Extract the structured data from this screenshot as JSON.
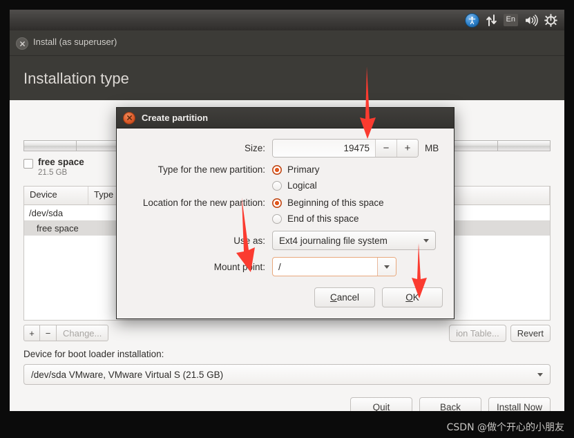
{
  "panel": {
    "tray": [
      {
        "name": "accessibility-icon",
        "label": "Accessibility"
      },
      {
        "name": "network-icon",
        "label": "Network"
      },
      {
        "name": "keyboard-layout-indicator",
        "label": "En"
      },
      {
        "name": "volume-icon",
        "label": "Volume"
      },
      {
        "name": "system-menu-icon",
        "label": "System"
      }
    ],
    "keyboard_layout": "En"
  },
  "installer": {
    "window_title": "Install (as superuser)",
    "page_title": "Installation type",
    "legend": {
      "name": "free space",
      "size": "21.5 GB"
    },
    "table": {
      "columns": [
        "Device",
        "Type",
        ""
      ],
      "rows": [
        {
          "device": "/dev/sda",
          "type": "",
          "extra": ""
        },
        {
          "device": "free space",
          "type": "",
          "extra": ""
        }
      ]
    },
    "toolbar": {
      "add_label": "+",
      "remove_label": "−",
      "change_label": "Change...",
      "new_partition_table_label": "ion Table...",
      "revert_label": "Revert"
    },
    "bootloader": {
      "label": "Device for boot loader installation:",
      "value": "/dev/sda VMware, VMware Virtual S (21.5 GB)"
    },
    "nav": {
      "quit_label": "Quit",
      "back_label": "Back",
      "install_label": "Install Now"
    }
  },
  "dialog": {
    "title": "Create partition",
    "size": {
      "label": "Size:",
      "value": "19475",
      "unit": "MB",
      "minus_label": "−",
      "plus_label": "+"
    },
    "type": {
      "label": "Type for the new partition:",
      "options": [
        "Primary",
        "Logical"
      ],
      "selected": "Primary"
    },
    "location": {
      "label": "Location for the new partition:",
      "options": [
        "Beginning of this space",
        "End of this space"
      ],
      "selected": "Beginning of this space"
    },
    "use_as": {
      "label": "Use as:",
      "value": "Ext4 journaling file system"
    },
    "mount_point": {
      "label": "Mount point:",
      "value": "/"
    },
    "buttons": {
      "cancel": {
        "pre": "",
        "mnemonic": "C",
        "post": "ancel"
      },
      "ok": {
        "pre": "",
        "mnemonic": "O",
        "post": "K"
      }
    }
  },
  "annotations": {
    "arrow_color": "#fb3b30",
    "arrows": [
      {
        "name": "arrow-to-size-field"
      },
      {
        "name": "arrow-to-mount-point"
      },
      {
        "name": "arrow-to-ok-button"
      }
    ]
  },
  "watermark": "CSDN @做个开心的小朋友"
}
